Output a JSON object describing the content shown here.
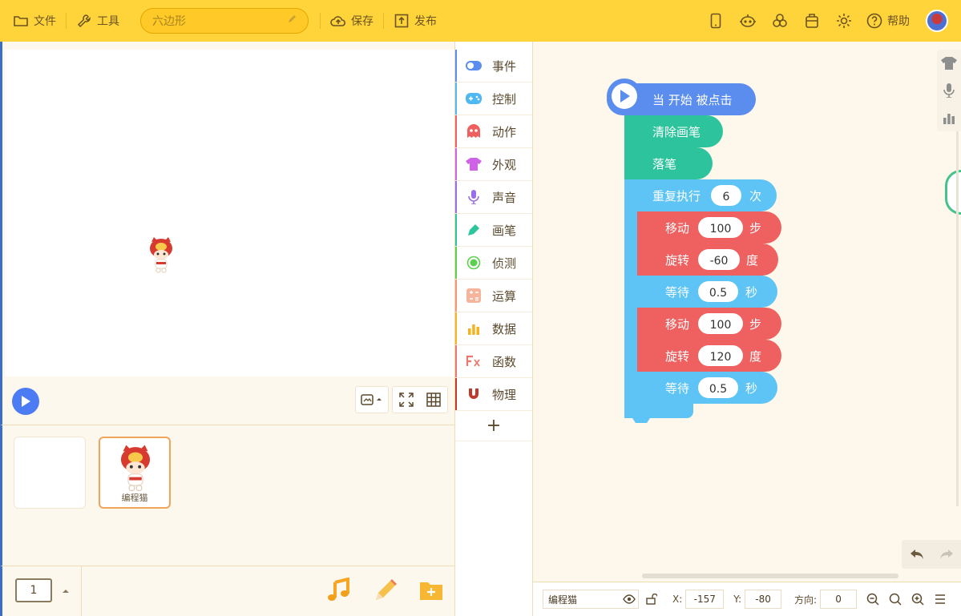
{
  "toolbar": {
    "file_label": "文件",
    "tools_label": "工具",
    "project_name": "六边形",
    "save_label": "保存",
    "publish_label": "发布",
    "help_label": "帮助"
  },
  "colors": {
    "toolbar_bg": "#ffd43b",
    "event": "#5b8def",
    "control": "#4fb8f2",
    "motion": "#ee5f5f",
    "looks": "#cf63e6",
    "sound": "#9a6ee6",
    "pen": "#2cc59c",
    "sensing": "#5ccf4f",
    "operators": "#f2957a",
    "data": "#f6b221",
    "functions": "#e9796f",
    "physics": "#c0392b"
  },
  "categories": [
    {
      "label": "事件",
      "icon": "toggle-icon"
    },
    {
      "label": "控制",
      "icon": "gamepad-icon"
    },
    {
      "label": "动作",
      "icon": "ghost-icon"
    },
    {
      "label": "外观",
      "icon": "shirt-icon"
    },
    {
      "label": "声音",
      "icon": "microphone-icon"
    },
    {
      "label": "画笔",
      "icon": "pen-icon"
    },
    {
      "label": "侦测",
      "icon": "radar-icon"
    },
    {
      "label": "运算",
      "icon": "calculator-icon"
    },
    {
      "label": "数据",
      "icon": "bar-chart-icon"
    },
    {
      "label": "函数",
      "icon": "function-icon"
    },
    {
      "label": "物理",
      "icon": "magnet-icon"
    }
  ],
  "category_add": "+",
  "blocks": {
    "hat": "当 开始 被点击",
    "clear": "清除画笔",
    "pen_down": "落笔",
    "repeat": {
      "label": "重复执行",
      "value": "6",
      "unit": "次"
    },
    "move1": {
      "label": "移动",
      "value": "100",
      "unit": "步"
    },
    "turn1": {
      "label": "旋转",
      "value": "-60",
      "unit": "度"
    },
    "wait1": {
      "label": "等待",
      "value": "0.5",
      "unit": "秒"
    },
    "move2": {
      "label": "移动",
      "value": "100",
      "unit": "步"
    },
    "turn2": {
      "label": "旋转",
      "value": "120",
      "unit": "度"
    },
    "wait2": {
      "label": "等待",
      "value": "0.5",
      "unit": "秒"
    }
  },
  "sprites": [
    {
      "name": ""
    },
    {
      "name": "编程猫"
    }
  ],
  "page_number": "1",
  "status": {
    "sprite_name": "编程猫",
    "x_label": "X:",
    "x_value": "-157",
    "y_label": "Y:",
    "y_value": "-80",
    "dir_label": "方向:",
    "dir_value": "0"
  }
}
